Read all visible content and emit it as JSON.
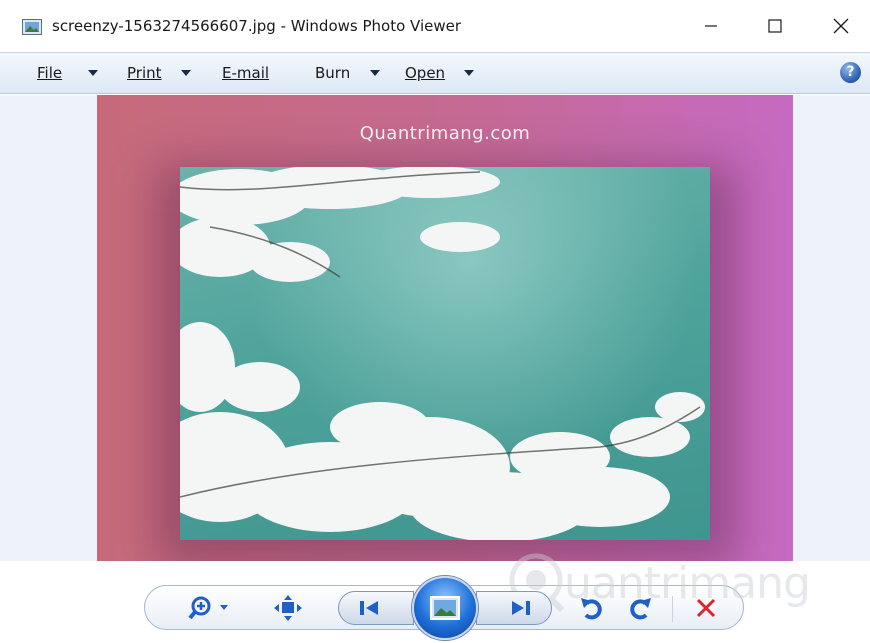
{
  "window": {
    "title": "screenzy-1563274566607.jpg - Windows Photo Viewer",
    "icon": "photo-viewer-icon",
    "controls": [
      "minimize-icon",
      "maximize-icon",
      "close-icon"
    ]
  },
  "menu": {
    "file": {
      "label": "File"
    },
    "print": {
      "label": "Print"
    },
    "email": {
      "label": "E-mail"
    },
    "burn": {
      "label": "Burn"
    },
    "open": {
      "label": "Open"
    },
    "help_icon": "help-icon"
  },
  "image": {
    "caption": "Quantrimang.com",
    "subject": "cherry-blossoms-over-water"
  },
  "toolbar": {
    "icons": [
      "zoom-icon",
      "actual-size-icon",
      "previous-icon",
      "slideshow-icon",
      "next-icon",
      "rotate-left-icon",
      "rotate-right-icon",
      "delete-icon"
    ]
  },
  "watermark": {
    "text": "uantrimang",
    "icon": "quantrimang-logo-icon"
  },
  "colors": {
    "menubar": "#dde8f4",
    "accent_blue": "#1e6fd9",
    "delete_red": "#d9262b",
    "background_pink": "#c56a90"
  }
}
